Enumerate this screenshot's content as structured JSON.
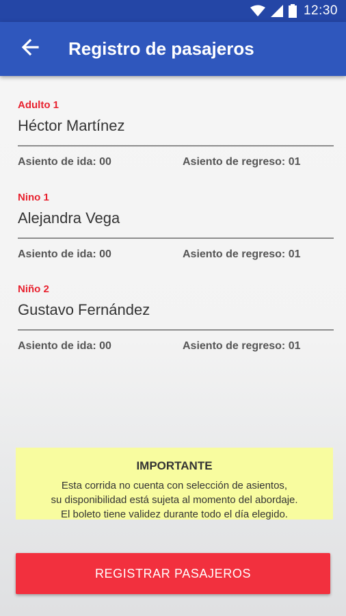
{
  "statusbar": {
    "time": "12:30",
    "icons": [
      "wifi-icon",
      "signal-icon",
      "battery-icon"
    ]
  },
  "appbar": {
    "title": "Registro de pasajeros",
    "back_icon": "arrow-left-icon"
  },
  "passengers": [
    {
      "label": "Adulto 1",
      "name": "Héctor Martínez",
      "seat_ida": "Asiento de ida: 00",
      "seat_regreso": "Asiento de regreso: 01"
    },
    {
      "label": "Nino 1",
      "name": "Alejandra Vega",
      "seat_ida": "Asiento de ida: 00",
      "seat_regreso": "Asiento de regreso: 01"
    },
    {
      "label": "Niño 2",
      "name": "Gustavo Fernández",
      "seat_ida": "Asiento de ida: 00",
      "seat_regreso": "Asiento de regreso: 01"
    }
  ],
  "notice": {
    "title": "IMPORTANTE",
    "line1": "Esta corrida no cuenta con selección de asientos,",
    "line2": "su disponibilidad está sujeta al momento del abordaje.",
    "line3": "El boleto tiene validez durante todo el día elegido."
  },
  "register_button": {
    "label": "REGISTRAR PASAJEROS"
  },
  "colors": {
    "statusbar": "#2446a6",
    "appbar": "#2f57bd",
    "accent_red": "#e8222f",
    "button_red": "#f2303e",
    "notice_yellow": "#f8fc9f"
  }
}
